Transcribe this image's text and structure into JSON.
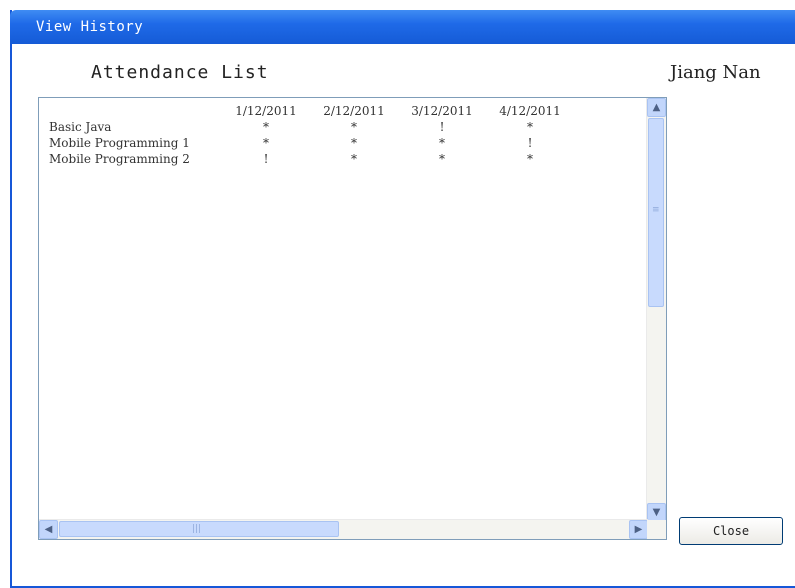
{
  "window": {
    "title": "View History"
  },
  "heading": "Attendance List",
  "user_name": "Jiang Nan",
  "attendance": {
    "dates": [
      "1/12/2011",
      "2/12/2011",
      "3/12/2011",
      "4/12/2011"
    ],
    "rows": [
      {
        "course": "Basic Java",
        "marks": [
          "*",
          "*",
          "!",
          "*"
        ]
      },
      {
        "course": "Mobile Programming 1",
        "marks": [
          "*",
          "*",
          "*",
          "!"
        ]
      },
      {
        "course": "Mobile Programming 2",
        "marks": [
          "!",
          "*",
          "*",
          "*"
        ]
      }
    ]
  },
  "scrollbar": {
    "up_icon": "up-arrow-icon",
    "down_icon": "down-arrow-icon",
    "left_icon": "left-arrow-icon",
    "right_icon": "right-arrow-icon"
  },
  "buttons": {
    "close": "Close"
  },
  "colors": {
    "titlebar": "#1f6ae8",
    "border": "#1657d8",
    "scroll_thumb": "#c8dafd"
  }
}
